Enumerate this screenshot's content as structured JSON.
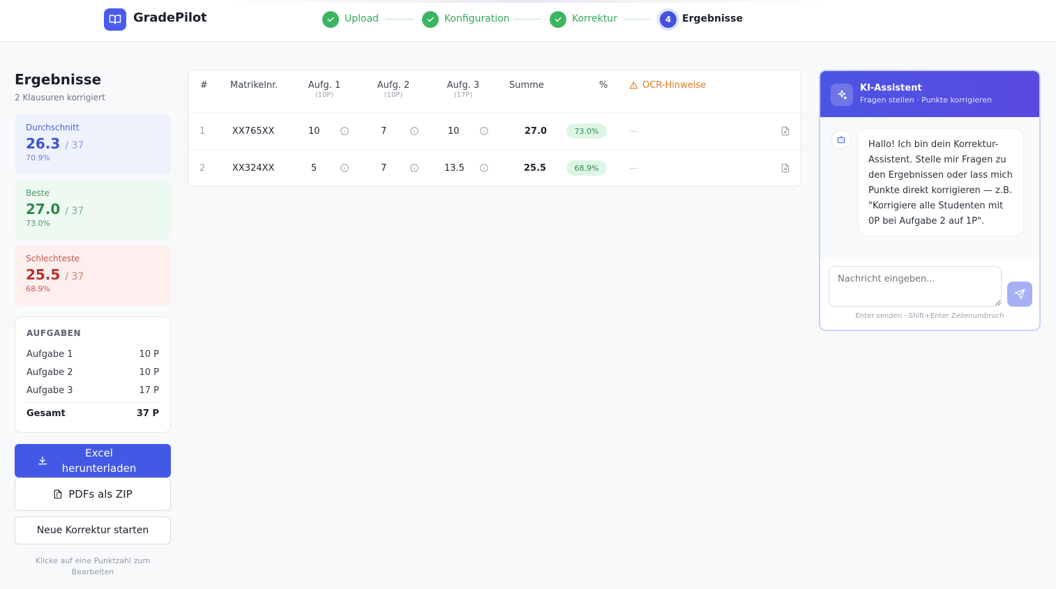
{
  "app": {
    "name": "GradePilot"
  },
  "steps": [
    {
      "label": "Upload",
      "state": "done"
    },
    {
      "label": "Konfiguration",
      "state": "done"
    },
    {
      "label": "Korrektur",
      "state": "done"
    },
    {
      "label": "Ergebnisse",
      "state": "active",
      "number": "4"
    }
  ],
  "summary": {
    "title": "Ergebnisse",
    "subtitle": "2 Klausuren korrigiert",
    "average": {
      "label": "Durchschnitt",
      "value": "26.3",
      "max": "/ 37",
      "percent": "70.9%"
    },
    "best": {
      "label": "Beste",
      "value": "27.0",
      "max": "/ 37",
      "percent": "73.0%"
    },
    "worst": {
      "label": "Schlechteste",
      "value": "25.5",
      "max": "/ 37",
      "percent": "68.9%"
    }
  },
  "tasks": {
    "heading": "AUFGABEN",
    "items": [
      {
        "name": "Aufgabe 1",
        "points": "10 P"
      },
      {
        "name": "Aufgabe 2",
        "points": "10 P"
      },
      {
        "name": "Aufgabe 3",
        "points": "17 P"
      }
    ],
    "total": {
      "name": "Gesamt",
      "points": "37 P"
    }
  },
  "actions": {
    "excel": "Excel herunterladen",
    "zip": "PDFs als ZIP",
    "new": "Neue Korrektur starten",
    "hint": "Klicke auf eine Punktzahl zum Bearbeiten"
  },
  "table": {
    "headers": {
      "idx": "#",
      "matrikel": "Matrikelnr.",
      "a1": "Aufg. 1",
      "a1_sub": "(10P)",
      "a2": "Aufg. 2",
      "a2_sub": "(10P)",
      "a3": "Aufg. 3",
      "a3_sub": "(17P)",
      "sum": "Summe",
      "pct": "%",
      "ocr": "OCR-Hinweise"
    },
    "rows": [
      {
        "idx": "1",
        "matrikel": "XX765XX",
        "a1": "10",
        "a2": "7",
        "a3": "10",
        "sum": "27.0",
        "pct": "73.0%",
        "ocr": "—"
      },
      {
        "idx": "2",
        "matrikel": "XX324XX",
        "a1": "5",
        "a2": "7",
        "a3": "13.5",
        "sum": "25.5",
        "pct": "68.9%",
        "ocr": "—"
      }
    ]
  },
  "chat": {
    "title": "KI-Assistent",
    "subtitle": "Fragen stellen · Punkte korrigieren",
    "message": "Hallo! Ich bin dein Korrektur-Assistent. Stelle mir Fragen zu den Ergebnissen oder lass mich Punkte direkt korrigieren — z.B. \"Korrigiere alle Studenten mit 0P bei Aufgabe 2 auf 1P\".",
    "placeholder": "Nachricht eingeben...",
    "hint": "Enter senden · Shift+Enter Zeilenumbruch"
  },
  "colors": {
    "accent": "#4359e6",
    "success": "#3cb563",
    "danger": "#b8322c",
    "warning": "#e07a1f"
  }
}
